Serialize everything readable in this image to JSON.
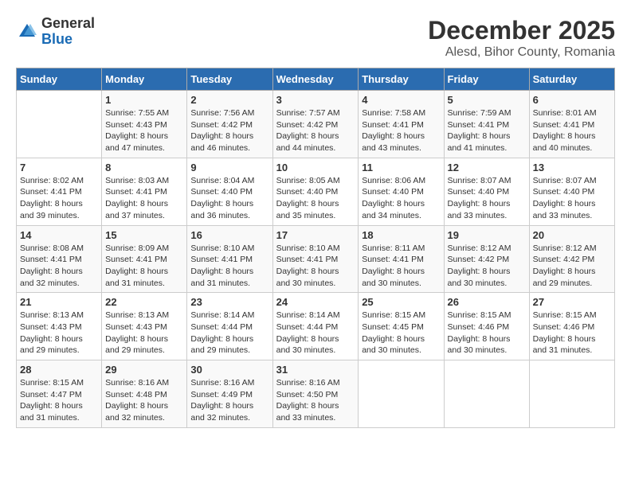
{
  "header": {
    "logo_general": "General",
    "logo_blue": "Blue",
    "title": "December 2025",
    "subtitle": "Alesd, Bihor County, Romania"
  },
  "weekdays": [
    "Sunday",
    "Monday",
    "Tuesday",
    "Wednesday",
    "Thursday",
    "Friday",
    "Saturday"
  ],
  "weeks": [
    [
      {
        "day": "",
        "sunrise": "",
        "sunset": "",
        "daylight": ""
      },
      {
        "day": "1",
        "sunrise": "Sunrise: 7:55 AM",
        "sunset": "Sunset: 4:43 PM",
        "daylight": "Daylight: 8 hours and 47 minutes."
      },
      {
        "day": "2",
        "sunrise": "Sunrise: 7:56 AM",
        "sunset": "Sunset: 4:42 PM",
        "daylight": "Daylight: 8 hours and 46 minutes."
      },
      {
        "day": "3",
        "sunrise": "Sunrise: 7:57 AM",
        "sunset": "Sunset: 4:42 PM",
        "daylight": "Daylight: 8 hours and 44 minutes."
      },
      {
        "day": "4",
        "sunrise": "Sunrise: 7:58 AM",
        "sunset": "Sunset: 4:41 PM",
        "daylight": "Daylight: 8 hours and 43 minutes."
      },
      {
        "day": "5",
        "sunrise": "Sunrise: 7:59 AM",
        "sunset": "Sunset: 4:41 PM",
        "daylight": "Daylight: 8 hours and 41 minutes."
      },
      {
        "day": "6",
        "sunrise": "Sunrise: 8:01 AM",
        "sunset": "Sunset: 4:41 PM",
        "daylight": "Daylight: 8 hours and 40 minutes."
      }
    ],
    [
      {
        "day": "7",
        "sunrise": "Sunrise: 8:02 AM",
        "sunset": "Sunset: 4:41 PM",
        "daylight": "Daylight: 8 hours and 39 minutes."
      },
      {
        "day": "8",
        "sunrise": "Sunrise: 8:03 AM",
        "sunset": "Sunset: 4:41 PM",
        "daylight": "Daylight: 8 hours and 37 minutes."
      },
      {
        "day": "9",
        "sunrise": "Sunrise: 8:04 AM",
        "sunset": "Sunset: 4:40 PM",
        "daylight": "Daylight: 8 hours and 36 minutes."
      },
      {
        "day": "10",
        "sunrise": "Sunrise: 8:05 AM",
        "sunset": "Sunset: 4:40 PM",
        "daylight": "Daylight: 8 hours and 35 minutes."
      },
      {
        "day": "11",
        "sunrise": "Sunrise: 8:06 AM",
        "sunset": "Sunset: 4:40 PM",
        "daylight": "Daylight: 8 hours and 34 minutes."
      },
      {
        "day": "12",
        "sunrise": "Sunrise: 8:07 AM",
        "sunset": "Sunset: 4:40 PM",
        "daylight": "Daylight: 8 hours and 33 minutes."
      },
      {
        "day": "13",
        "sunrise": "Sunrise: 8:07 AM",
        "sunset": "Sunset: 4:40 PM",
        "daylight": "Daylight: 8 hours and 33 minutes."
      }
    ],
    [
      {
        "day": "14",
        "sunrise": "Sunrise: 8:08 AM",
        "sunset": "Sunset: 4:41 PM",
        "daylight": "Daylight: 8 hours and 32 minutes."
      },
      {
        "day": "15",
        "sunrise": "Sunrise: 8:09 AM",
        "sunset": "Sunset: 4:41 PM",
        "daylight": "Daylight: 8 hours and 31 minutes."
      },
      {
        "day": "16",
        "sunrise": "Sunrise: 8:10 AM",
        "sunset": "Sunset: 4:41 PM",
        "daylight": "Daylight: 8 hours and 31 minutes."
      },
      {
        "day": "17",
        "sunrise": "Sunrise: 8:10 AM",
        "sunset": "Sunset: 4:41 PM",
        "daylight": "Daylight: 8 hours and 30 minutes."
      },
      {
        "day": "18",
        "sunrise": "Sunrise: 8:11 AM",
        "sunset": "Sunset: 4:41 PM",
        "daylight": "Daylight: 8 hours and 30 minutes."
      },
      {
        "day": "19",
        "sunrise": "Sunrise: 8:12 AM",
        "sunset": "Sunset: 4:42 PM",
        "daylight": "Daylight: 8 hours and 30 minutes."
      },
      {
        "day": "20",
        "sunrise": "Sunrise: 8:12 AM",
        "sunset": "Sunset: 4:42 PM",
        "daylight": "Daylight: 8 hours and 29 minutes."
      }
    ],
    [
      {
        "day": "21",
        "sunrise": "Sunrise: 8:13 AM",
        "sunset": "Sunset: 4:43 PM",
        "daylight": "Daylight: 8 hours and 29 minutes."
      },
      {
        "day": "22",
        "sunrise": "Sunrise: 8:13 AM",
        "sunset": "Sunset: 4:43 PM",
        "daylight": "Daylight: 8 hours and 29 minutes."
      },
      {
        "day": "23",
        "sunrise": "Sunrise: 8:14 AM",
        "sunset": "Sunset: 4:44 PM",
        "daylight": "Daylight: 8 hours and 29 minutes."
      },
      {
        "day": "24",
        "sunrise": "Sunrise: 8:14 AM",
        "sunset": "Sunset: 4:44 PM",
        "daylight": "Daylight: 8 hours and 30 minutes."
      },
      {
        "day": "25",
        "sunrise": "Sunrise: 8:15 AM",
        "sunset": "Sunset: 4:45 PM",
        "daylight": "Daylight: 8 hours and 30 minutes."
      },
      {
        "day": "26",
        "sunrise": "Sunrise: 8:15 AM",
        "sunset": "Sunset: 4:46 PM",
        "daylight": "Daylight: 8 hours and 30 minutes."
      },
      {
        "day": "27",
        "sunrise": "Sunrise: 8:15 AM",
        "sunset": "Sunset: 4:46 PM",
        "daylight": "Daylight: 8 hours and 31 minutes."
      }
    ],
    [
      {
        "day": "28",
        "sunrise": "Sunrise: 8:15 AM",
        "sunset": "Sunset: 4:47 PM",
        "daylight": "Daylight: 8 hours and 31 minutes."
      },
      {
        "day": "29",
        "sunrise": "Sunrise: 8:16 AM",
        "sunset": "Sunset: 4:48 PM",
        "daylight": "Daylight: 8 hours and 32 minutes."
      },
      {
        "day": "30",
        "sunrise": "Sunrise: 8:16 AM",
        "sunset": "Sunset: 4:49 PM",
        "daylight": "Daylight: 8 hours and 32 minutes."
      },
      {
        "day": "31",
        "sunrise": "Sunrise: 8:16 AM",
        "sunset": "Sunset: 4:50 PM",
        "daylight": "Daylight: 8 hours and 33 minutes."
      },
      {
        "day": "",
        "sunrise": "",
        "sunset": "",
        "daylight": ""
      },
      {
        "day": "",
        "sunrise": "",
        "sunset": "",
        "daylight": ""
      },
      {
        "day": "",
        "sunrise": "",
        "sunset": "",
        "daylight": ""
      }
    ]
  ]
}
